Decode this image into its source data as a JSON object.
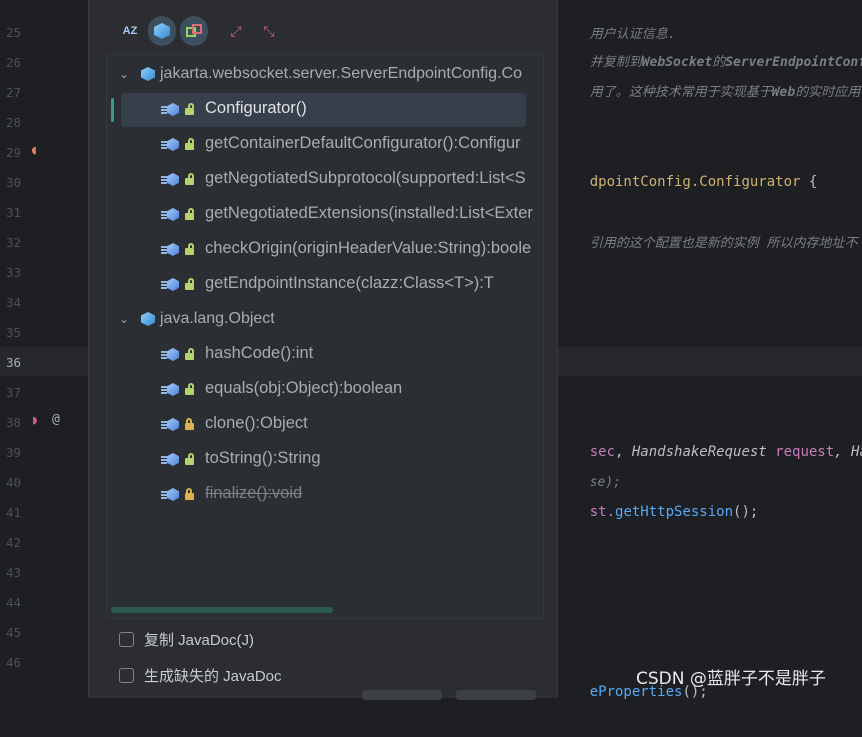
{
  "editor": {
    "line_numbers": [
      "25",
      "26",
      "27",
      "28",
      "29",
      "30",
      "31",
      "32",
      "33",
      "34",
      "35",
      "36",
      "37",
      "38",
      "39",
      "40",
      "41",
      "42",
      "43",
      "44",
      "45",
      "46"
    ],
    "active_line": "36",
    "code": {
      "l24_tail": "用户认证信息.",
      "l25_a": "并复制到",
      "l25_b": "WebSocket",
      "l25_c": "的",
      "l25_d": "ServerEndpointConf",
      "l26_a": "用了。这种技术常用于实现基于",
      "l26_b": "Web",
      "l26_c": "的实时应用",
      "l29_a": "dpointConfig.",
      "l29_b": "Configurator",
      "l29_c": " {",
      "l31": "引用的这个配置也是新的实例 所以内存地址不",
      "l38_a": "sec",
      "l38_b": ", ",
      "l38_c": "HandshakeRequest",
      "l38_d": " request",
      "l38_e": ", Ha",
      "l39": "se);",
      "l40_a": "st.",
      "l40_b": "getHttpSession",
      "l40_c": "();",
      "l46_a": "eProperties",
      "l46_b": "();"
    },
    "at_symbol": "@"
  },
  "popup": {
    "toolbar": {
      "sort_alpha_label": "AZ",
      "show_fields_icon": "cube-icon",
      "show_inherited_icon": "inherited-icon",
      "expand_all_label": "↗↙",
      "collapse_all_label": "↙↗"
    },
    "tree": {
      "class_node": "jakarta.websocket.server.ServerEndpointConfig.Co",
      "class_methods": [
        {
          "label": "Configurator()",
          "lock": "open",
          "selected": true,
          "deprecated": false
        },
        {
          "label": "getContainerDefaultConfigurator():Configur",
          "lock": "open",
          "selected": false,
          "deprecated": false
        },
        {
          "label": "getNegotiatedSubprotocol(supported:List<S",
          "lock": "open",
          "selected": false,
          "deprecated": false
        },
        {
          "label": "getNegotiatedExtensions(installed:List<Exter",
          "lock": "open",
          "selected": false,
          "deprecated": false
        },
        {
          "label": "checkOrigin(originHeaderValue:String):boole",
          "lock": "open",
          "selected": false,
          "deprecated": false
        },
        {
          "label": "getEndpointInstance(clazz:Class<T>):T",
          "lock": "open",
          "selected": false,
          "deprecated": false
        }
      ],
      "object_node": "java.lang.Object",
      "object_methods": [
        {
          "label": "hashCode():int",
          "lock": "open",
          "deprecated": false
        },
        {
          "label": "equals(obj:Object):boolean",
          "lock": "open",
          "deprecated": false
        },
        {
          "label": "clone():Object",
          "lock": "closed",
          "deprecated": false
        },
        {
          "label": "toString():String",
          "lock": "open",
          "deprecated": false
        },
        {
          "label": "finalize():void",
          "lock": "closed",
          "deprecated": true
        }
      ]
    },
    "options": {
      "copy_javadoc": "复制 JavaDoc(J)",
      "generate_missing_javadoc": "生成缺失的 JavaDoc"
    }
  },
  "watermark": "CSDN @蓝胖子不是胖子",
  "colors": {
    "background": "#1e1f22",
    "popup": "#2b2d30",
    "selection": "#37404a",
    "accent": "#3a9a88"
  }
}
